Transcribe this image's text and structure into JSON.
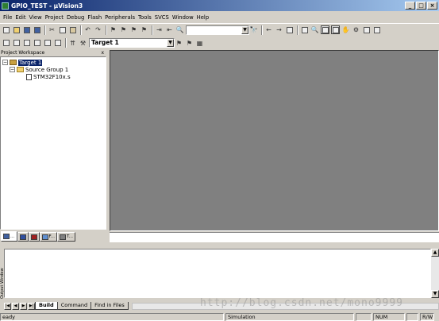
{
  "window": {
    "title": "GPIO_TEST - µVision3",
    "title_left": "GPIO_TEST",
    "title_right": "µVision3",
    "controls": [
      "_",
      "□",
      "×"
    ]
  },
  "menu": [
    "File",
    "Edit",
    "View",
    "Project",
    "Debug",
    "Flash",
    "Peripherals",
    "Tools",
    "SVCS",
    "Window",
    "Help"
  ],
  "toolbar": {
    "target_combo": "Target 1"
  },
  "workspace": {
    "title": "Project Workspace",
    "close": "x",
    "tree": {
      "target": "Target 1",
      "group": "Source Group 1",
      "file": "STM32F10x.s"
    },
    "tabs": [
      "F...",
      "T..."
    ]
  },
  "output": {
    "side_label": "Output Window",
    "tabs": [
      "Build",
      "Command",
      "Find in Files"
    ],
    "active_tab": "Build"
  },
  "status": {
    "left": "eady",
    "mode": "Simulation",
    "num": "NUM",
    "rw": "R/W"
  },
  "watermark": "http://blog.csdn.net/mono9999"
}
